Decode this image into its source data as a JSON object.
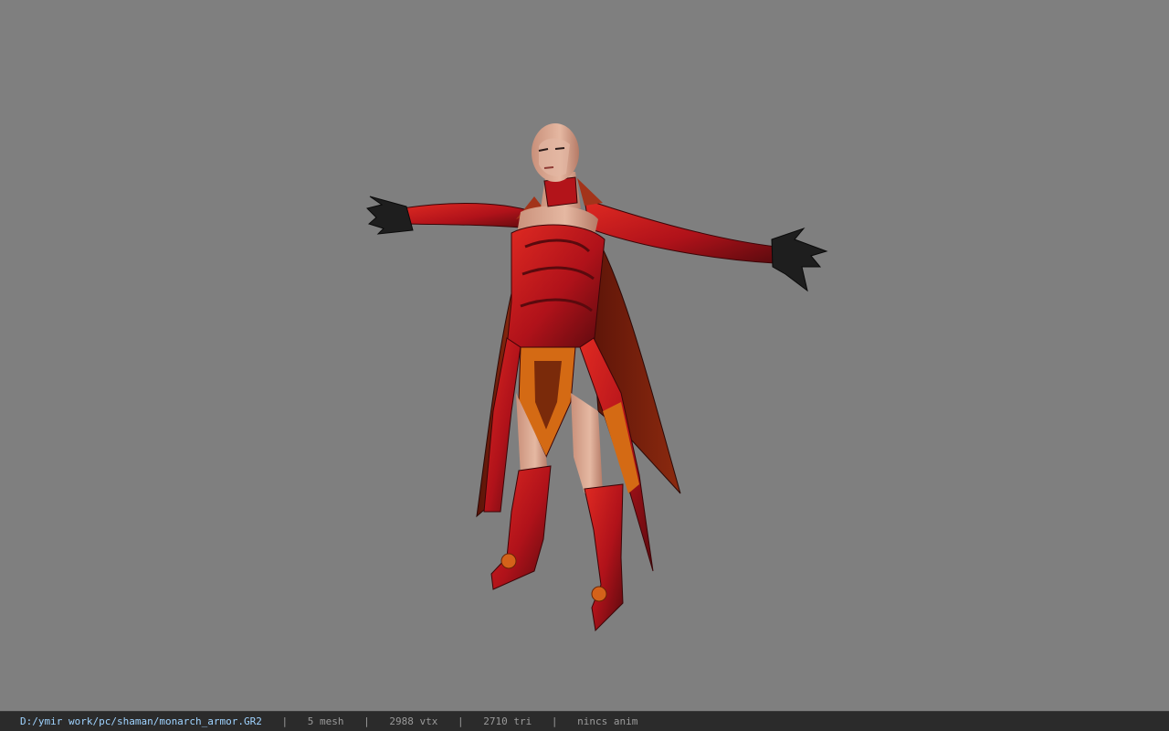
{
  "viewport": {
    "background_color": "#7f7f7f",
    "model_icon": "character-model-icon"
  },
  "statusbar": {
    "file_path": "D:/ymir work/pc/shaman/monarch_armor.GR2",
    "separator": "|",
    "mesh_count": "5 mesh",
    "vertex_count": "2988 vtx",
    "triangle_count": "2710 tri",
    "animation": "nincs anim"
  },
  "colors": {
    "statusbar_bg": "#2b2b2b",
    "file_path_text": "#9fd3ff",
    "status_text": "#9a9a9a",
    "armor_red": "#c8141a",
    "armor_dark": "#5a0a0e",
    "orange_trim": "#d46a14",
    "skin": "#d7a58a"
  }
}
